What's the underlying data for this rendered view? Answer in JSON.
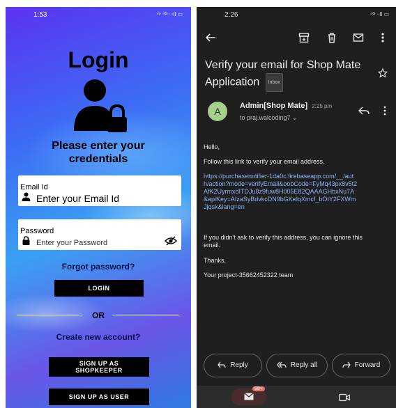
{
  "login_screen": {
    "status": {
      "time": "1:53",
      "icons": "ᵛᵒ ⁴ᴳ ᐧᐧᐧll ▭"
    },
    "title": "Login",
    "subtitle_line1": "Please enter your",
    "subtitle_line2": "credentials",
    "email": {
      "label": "Email Id",
      "placeholder": "Enter your Email Id"
    },
    "password": {
      "label": "Password",
      "placeholder": "Enter your Password"
    },
    "forgot_password": "Forgot password?",
    "login_button": "LOGIN",
    "or_text": "OR",
    "create_account": "Create new account?",
    "signup_shopkeeper_line1": "SIGN UP AS",
    "signup_shopkeeper_line2": "SHOPKEEPER",
    "signup_user": "SIGN UP AS USER"
  },
  "email_screen": {
    "status": {
      "time": "2:26",
      "icons": "⁴ᴳ ᐧᐧll ▭"
    },
    "subject": "Verify your email for Shop Mate Application",
    "label_chip": "Inbox",
    "avatar_letter": "A",
    "sender": "Admin[Shop Mate]",
    "sent_time": "2:25 pm",
    "recipient": "to praj.walcoding7 ⌄",
    "body": {
      "greeting": "Hello,",
      "instruction": "Follow this link to verify your email address.",
      "link": "https://purchasenotifier-1da0c.firebaseapp.com/__/auth/action?mode=verifyEmail&oobCode=FyMq43px8v5t2AfK2UyrmxdITDJu8z9fuw8H005E82QAAAGHbxNu7A&apiKey=AIzaSyBdvkcDN9bGKelqXmcf_bOtY2FXWmJjqsk&lang=en",
      "disclaimer": "If you didn't ask to verify this address, you can ignore this email.",
      "thanks": "Thanks,",
      "signature": "Your project-35662452322 team"
    },
    "actions": {
      "reply": "Reply",
      "reply_all": "Reply all",
      "forward": "Forward"
    },
    "badge": "99+"
  }
}
